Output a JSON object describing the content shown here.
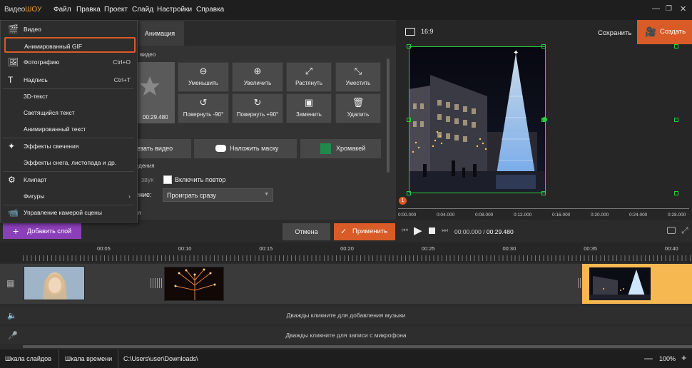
{
  "app": {
    "logo_a": "Видео",
    "logo_b": "ШОУ"
  },
  "menu": [
    "Файл",
    "Правка",
    "Проект",
    "Слайд",
    "Настройки",
    "Справка"
  ],
  "tabs": {
    "animation": "Анимация"
  },
  "section": {
    "video_suffix": "видео",
    "effects_suffix": "едения",
    "tail": "я"
  },
  "thumb": {
    "time": "00:29.480"
  },
  "tools": [
    {
      "label": "Уменьшить",
      "icon": "zoom-out-icon",
      "glyph": "⊖"
    },
    {
      "label": "Увеличить",
      "icon": "zoom-in-icon",
      "glyph": "⊕"
    },
    {
      "label": "Растянуть",
      "icon": "expand-icon",
      "glyph": "⤢"
    },
    {
      "label": "Уместить",
      "icon": "fit-icon",
      "glyph": "⤡"
    },
    {
      "label": "Повернуть -90°",
      "icon": "rotate-left-icon",
      "glyph": "↺"
    },
    {
      "label": "Повернуть +90°",
      "icon": "rotate-right-icon",
      "glyph": "↻"
    },
    {
      "label": "Заменить",
      "icon": "replace-icon",
      "glyph": "▣"
    },
    {
      "label": "Удалить",
      "icon": "trash-icon",
      "glyph": "🗑"
    }
  ],
  "actions": {
    "crop": "езать видео",
    "mask": "Наложить маску",
    "chroma": "Хромакей"
  },
  "sound": {
    "mute_label": "звук",
    "repeat_label": "Включить повтор"
  },
  "playback": {
    "label": "ение:",
    "value": "Проиграть сразу"
  },
  "preview": {
    "ratio": "16:9",
    "save": "Сохранить",
    "create": "Создать",
    "marker": "1"
  },
  "preview_ticks": [
    "0:00.000",
    "0:04.000",
    "0:08.000",
    "0:12.000",
    "0:16.000",
    "0:20.000",
    "0:24.000",
    "0:28.000"
  ],
  "controls": {
    "add_layer": "Добавить слой",
    "cancel": "Отмена",
    "apply": "Применить",
    "time_current": "00:00.000",
    "time_sep": " / ",
    "time_total": "00:29.480"
  },
  "timeline_ticks": [
    "00:05",
    "00:10",
    "00:15",
    "00:20",
    "00:25",
    "00:30",
    "00:35",
    "00:40"
  ],
  "tracks": {
    "music_hint": "Дважды кликните для добавления музыки",
    "mic_hint": "Дважды кликните для записи с микрофона"
  },
  "status": {
    "slides": "Шкала слайдов",
    "timeline": "Шкала времени",
    "path": "C:\\Users\\user\\Downloads\\",
    "zoom": "100%"
  },
  "dropdown": [
    {
      "label": "Видео",
      "icon": "clapper-icon",
      "glyph": "🎬",
      "shortcut": ""
    },
    {
      "label": "Анимированный GIF",
      "icon": "",
      "glyph": "",
      "shortcut": "",
      "highlight": true
    },
    {
      "label": "Фотографию",
      "icon": "image-icon",
      "glyph": "🖼",
      "shortcut": "Ctrl+O"
    },
    {
      "label": "Надпись",
      "icon": "text-icon",
      "glyph": "T",
      "shortcut": "Ctrl+T"
    },
    {
      "label": "3D-текст",
      "icon": "",
      "glyph": "",
      "shortcut": ""
    },
    {
      "label": "Светящийся текст",
      "icon": "",
      "glyph": "",
      "shortcut": ""
    },
    {
      "label": "Анимированный текст",
      "icon": "",
      "glyph": "",
      "shortcut": ""
    },
    {
      "label": "Эффекты свечения",
      "icon": "magic-wand-icon",
      "glyph": "✦",
      "shortcut": ""
    },
    {
      "label": "Эффекты снега, листопада и др.",
      "icon": "",
      "glyph": "",
      "shortcut": ""
    },
    {
      "label": "Клипарт",
      "icon": "gear-icon",
      "glyph": "⚙",
      "shortcut": ""
    },
    {
      "label": "Фигуры",
      "icon": "",
      "glyph": "",
      "shortcut": "›"
    },
    {
      "label": "Управление камерой сцены",
      "icon": "camera-icon",
      "glyph": "📹",
      "shortcut": ""
    }
  ],
  "colors": {
    "accent": "#d95b27",
    "purple": "#8b3fb8",
    "chroma": "#1f8a4c",
    "clip_selected": "#f6b952"
  }
}
